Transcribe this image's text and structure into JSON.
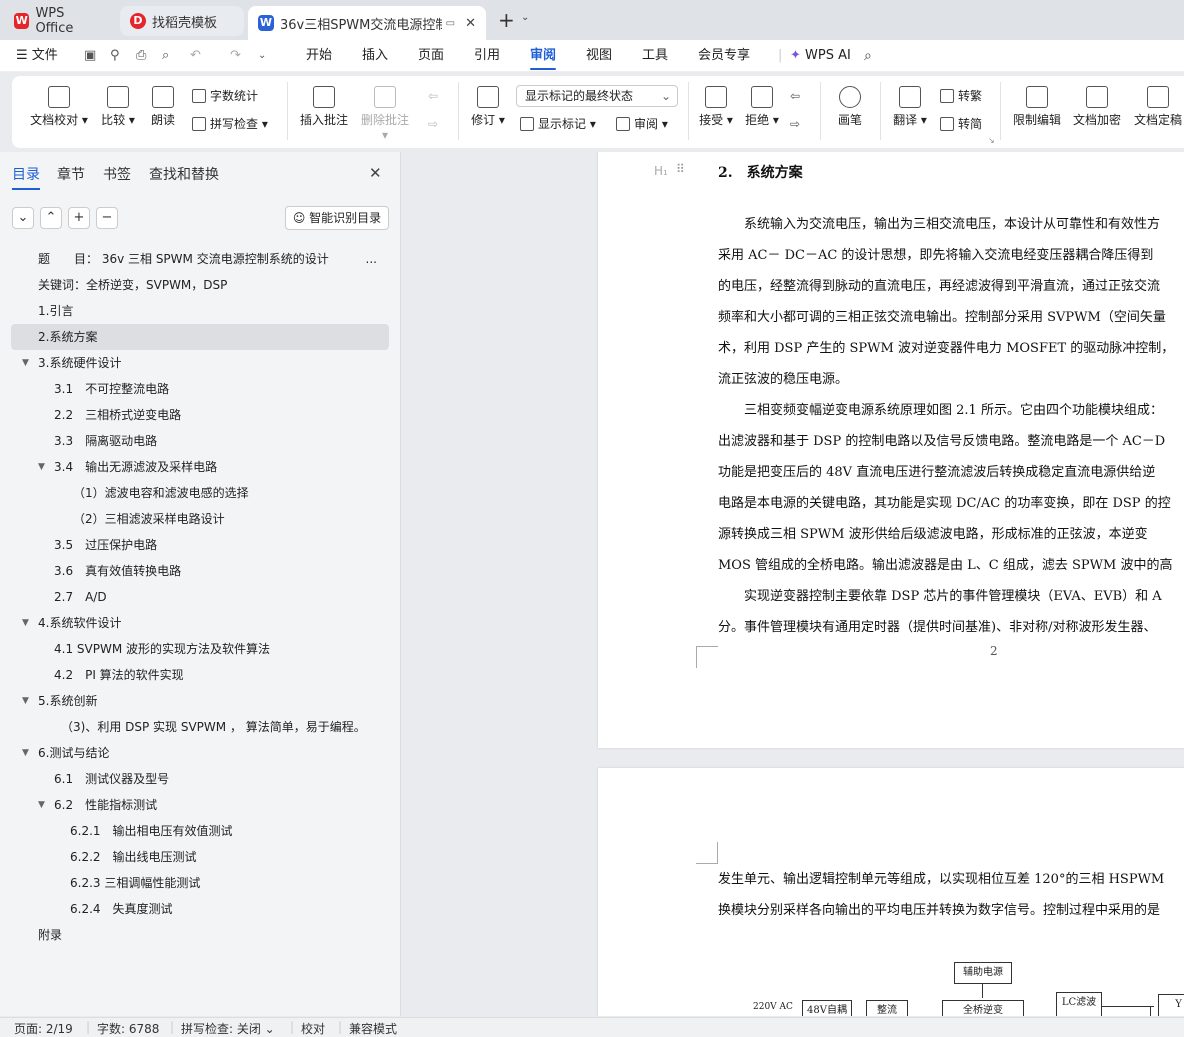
{
  "tabs": [
    {
      "label": "WPS Office"
    },
    {
      "label": "找稻壳模板"
    },
    {
      "label": "36v三相SPWM交流电源控制"
    }
  ],
  "menu": {
    "file": "文件",
    "items": [
      "开始",
      "插入",
      "页面",
      "引用",
      "审阅",
      "视图",
      "工具",
      "会员专享"
    ],
    "ai": "WPS AI"
  },
  "ribbon": {
    "doc_check": "文档校对",
    "compare": "比较",
    "read_aloud": "朗读",
    "word_count": "字数统计",
    "spell_check": "拼写检查",
    "insert_comment": "插入批注",
    "delete_comment": "删除批注",
    "revise": "修订",
    "markup_state": "显示标记的最终状态",
    "show_markup": "显示标记",
    "review": "审阅",
    "accept": "接受",
    "reject": "拒绝",
    "brush": "画笔",
    "translate": "翻译",
    "to_traditional": "转繁",
    "to_simplified": "转简",
    "restrict_edit": "限制编辑",
    "encrypt": "文档加密",
    "finalize": "文档定稿"
  },
  "sidebar": {
    "tabs": [
      "目录",
      "章节",
      "书签",
      "查找和替换"
    ],
    "smart_toc": "智能识别目录",
    "toc": [
      {
        "text": "题　　目：  36v 三相 SPWM 交流电源控制系统的设计",
        "indent": 27
      },
      {
        "text": "关键词：全桥逆变，SVPWM，DSP",
        "indent": 27
      },
      {
        "text": "1.引言",
        "indent": 27
      },
      {
        "text": "2.系统方案",
        "indent": 27
      },
      {
        "text": "3.系统硬件设计",
        "indent": 27
      },
      {
        "text": "3.1　不可控整流电路",
        "indent": 43
      },
      {
        "text": "2.2　三相桥式逆变电路",
        "indent": 43
      },
      {
        "text": "3.3　隔离驱动电路",
        "indent": 43
      },
      {
        "text": "3.4　输出无源滤波及采样电路",
        "indent": 43
      },
      {
        "text": "（1）滤波电容和滤波电感的选择",
        "indent": 62
      },
      {
        "text": "（2）三相滤波采样电路设计",
        "indent": 62
      },
      {
        "text": "3.5　过压保护电路",
        "indent": 43
      },
      {
        "text": "3.6　真有效值转换电路",
        "indent": 43
      },
      {
        "text": "2.7　A/D",
        "indent": 43
      },
      {
        "text": "4.系统软件设计",
        "indent": 27
      },
      {
        "text": "4.1 SVPWM 波形的实现方法及软件算法",
        "indent": 43
      },
      {
        "text": "4.2　PI 算法的软件实现",
        "indent": 43
      },
      {
        "text": "5.系统创新",
        "indent": 27
      },
      {
        "text": "（3)、利用 DSP  实现 SVPWM ， 算法简单，易于编程。",
        "indent": 50
      },
      {
        "text": "6.测试与结论",
        "indent": 27
      },
      {
        "text": "6.1　测试仪器及型号",
        "indent": 43
      },
      {
        "text": "6.2　性能指标测试",
        "indent": 43
      },
      {
        "text": "6.2.1　输出相电压有效值测试",
        "indent": 59
      },
      {
        "text": "6.2.2　输出线电压测试",
        "indent": 59
      },
      {
        "text": "6.2.3 三相调幅性能测试",
        "indent": 59
      },
      {
        "text": "6.2.4　失真度测试",
        "indent": 59
      },
      {
        "text": "附录",
        "indent": 27
      }
    ]
  },
  "document": {
    "heading": "2.　系统方案",
    "para1": [
      "　　系统输入为交流电压，输出为三相交流电压，本设计从可靠性和有效性方",
      "采用 AC－ DC－AC 的设计思想，即先将输入交流电经变压器耦合降压得到",
      "的电压，经整流得到脉动的直流电压，再经滤波得到平滑直流，通过正弦交流",
      "频率和大小都可调的三相正弦交流电输出。控制部分采用 SVPWM（空间矢量",
      "术，利用 DSP 产生的 SPWM 波对逆变器件电力 MOSFET 的驱动脉冲控制，",
      "流正弦波的稳压电源。",
      "　　三相变频变幅逆变电源系统原理如图 2.1 所示。它由四个功能模块组成：",
      "出滤波器和基于 DSP 的控制电路以及信号反馈电路。整流电路是一个 AC－D",
      "功能是把变压后的 48V 直流电压进行整流滤波后转换成稳定直流电源供给逆",
      "电路是本电源的关键电路，其功能是实现 DC/AC 的功率变换，即在 DSP 的控",
      "源转换成三相 SPWM 波形供给后级滤波电路，形成标准的正弦波，本逆变",
      "MOS 管组成的全桥电路。输出滤波器是由 L、C 组成，滤去 SPWM 波中的高",
      "　　实现逆变器控制主要依靠 DSP 芯片的事件管理模块（EVA、EVB）和 A",
      "分。事件管理模块有通用定时器（提供时间基准)、非对称/对称波形发生器、"
    ],
    "page_number": "2",
    "para2": [
      "发生单元、输出逻辑控制单元等组成，以实现相位互差 120°的三相 HSPWM",
      "换模块分别采样各向输出的平均电压并转换为数字信号。控制过程中采用的是"
    ],
    "diagram": {
      "aux": "辅助电源",
      "input": "220V AC",
      "b1": "48V自耦",
      "b2": "整流",
      "b3": "全桥逆变",
      "b4": "LC滤波",
      "b5": "Y"
    }
  },
  "status": {
    "page": "页面: 2/19",
    "words": "字数: 6788",
    "spell": "拼写检查: 关闭",
    "proof": "校对",
    "compat": "兼容模式"
  }
}
